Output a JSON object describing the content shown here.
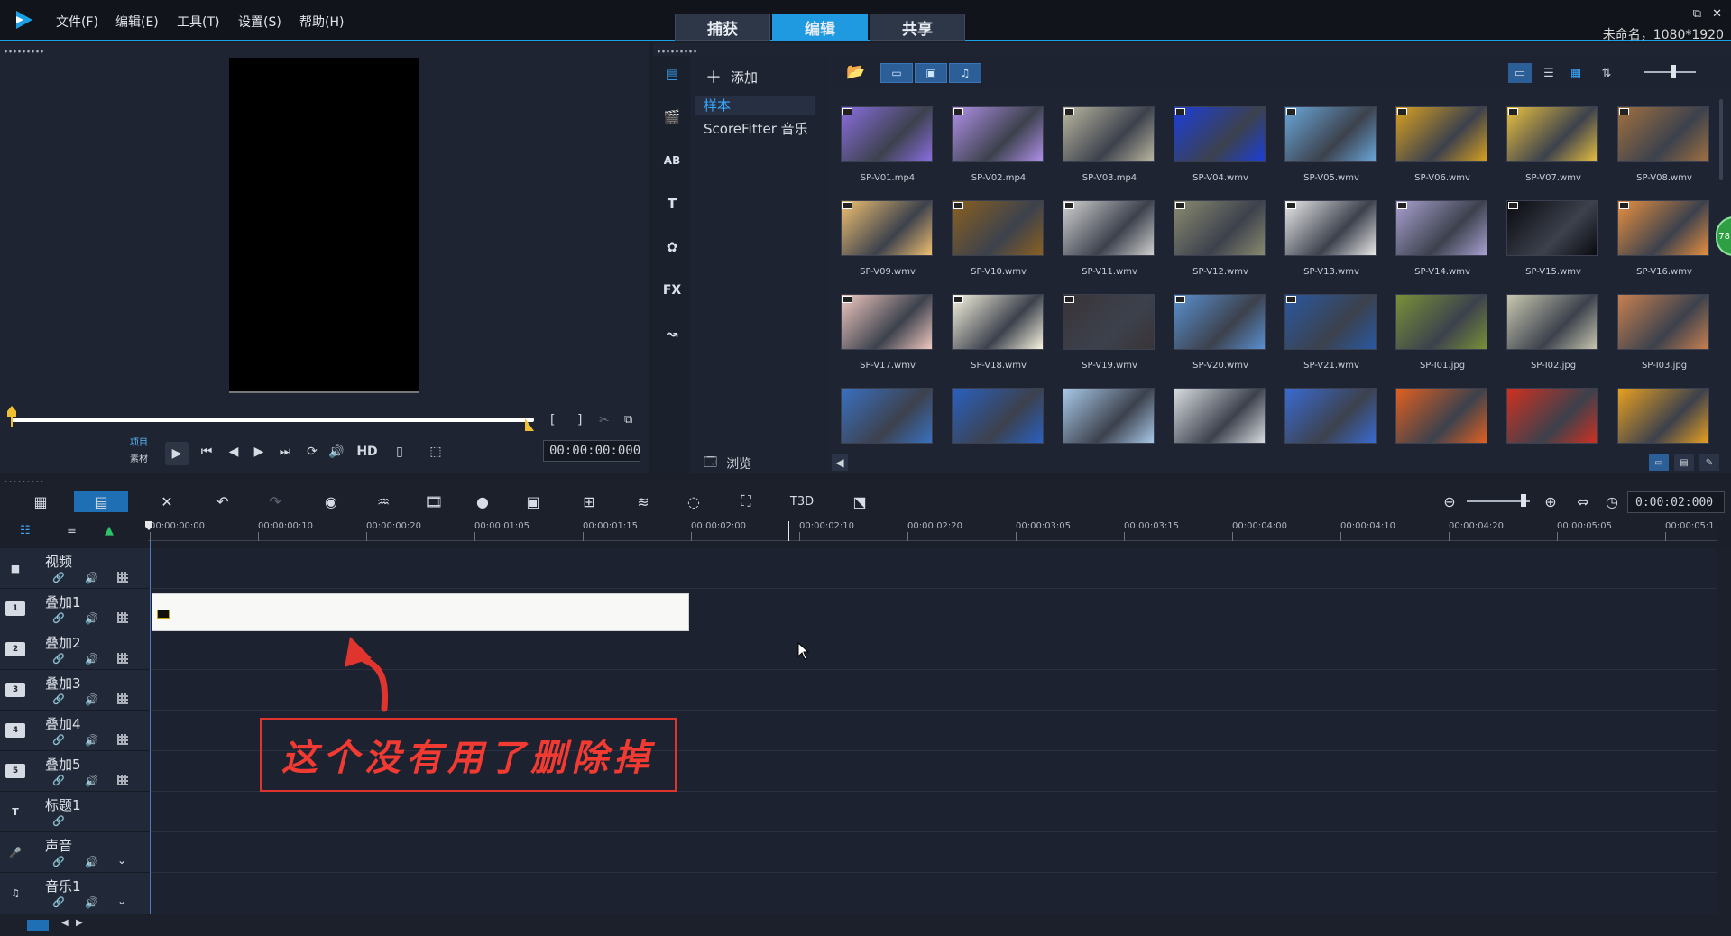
{
  "menu": [
    "文件(F)",
    "编辑(E)",
    "工具(T)",
    "设置(S)",
    "帮助(H)"
  ],
  "mode_tabs": [
    "捕获",
    "编辑",
    "共享"
  ],
  "window_controls": [
    "—",
    "⧉",
    "✕"
  ],
  "project_info": "未命名，1080*1920",
  "player": {
    "mode_project": "项目",
    "mode_clip": "素材",
    "hd_label": "HD",
    "timecode": "00:00:00:000"
  },
  "library": {
    "add_label": "添加",
    "tree_items": [
      "样本",
      "ScoreFitter 音乐"
    ],
    "browse_label": "浏览",
    "side_icons": [
      "media-icon",
      "instant-project-icon",
      "transition-icon",
      "title-icon",
      "graphic-icon",
      "filter-icon",
      "path-icon"
    ],
    "badge": "78",
    "thumbnails": [
      {
        "label": "SP-V01.mp4",
        "color": "#8a6ee0",
        "video": true
      },
      {
        "label": "SP-V02.mp4",
        "color": "#b090e8",
        "video": true
      },
      {
        "label": "SP-V03.mp4",
        "color": "#bab6a0",
        "video": true
      },
      {
        "label": "SP-V04.wmv",
        "color": "#1c3ed8",
        "video": true
      },
      {
        "label": "SP-V05.wmv",
        "color": "#6aa6d8",
        "video": true
      },
      {
        "label": "SP-V06.wmv",
        "color": "#d8a020",
        "video": true
      },
      {
        "label": "SP-V07.wmv",
        "color": "#e8c040",
        "video": true
      },
      {
        "label": "SP-V08.wmv",
        "color": "#a07040",
        "video": true
      },
      {
        "label": "SP-V09.wmv",
        "color": "#f0c070",
        "video": true
      },
      {
        "label": "SP-V10.wmv",
        "color": "#8a6020",
        "video": true
      },
      {
        "label": "SP-V11.wmv",
        "color": "#d0d0d0",
        "video": true
      },
      {
        "label": "SP-V12.wmv",
        "color": "#8a8a70",
        "video": true
      },
      {
        "label": "SP-V13.wmv",
        "color": "#e8e8e8",
        "video": true
      },
      {
        "label": "SP-V14.wmv",
        "color": "#a8a0d0",
        "video": true
      },
      {
        "label": "SP-V15.wmv",
        "color": "#0a0a10",
        "video": true
      },
      {
        "label": "SP-V16.wmv",
        "color": "#e89040",
        "video": true
      },
      {
        "label": "SP-V17.wmv",
        "color": "#f0c8c0",
        "video": true
      },
      {
        "label": "SP-V18.wmv",
        "color": "#f8f4e0",
        "video": true
      },
      {
        "label": "SP-V19.wmv",
        "color": "#3a3438",
        "video": true
      },
      {
        "label": "SP-V20.wmv",
        "color": "#5a90d0",
        "video": true
      },
      {
        "label": "SP-V21.wmv",
        "color": "#2a58a0",
        "video": true
      },
      {
        "label": "SP-I01.jpg",
        "color": "#7a9038",
        "video": false
      },
      {
        "label": "SP-I02.jpg",
        "color": "#c8c8b0",
        "video": false
      },
      {
        "label": "SP-I03.jpg",
        "color": "#c88050",
        "video": false
      },
      {
        "label": "",
        "color": "#3a70c0",
        "video": false
      },
      {
        "label": "",
        "color": "#2a60c0",
        "video": false
      },
      {
        "label": "",
        "color": "#a8c8e8",
        "video": false
      },
      {
        "label": "",
        "color": "#d8dce0",
        "video": false
      },
      {
        "label": "",
        "color": "#3a6ad0",
        "video": false
      },
      {
        "label": "",
        "color": "#e06020",
        "video": false
      },
      {
        "label": "",
        "color": "#d03020",
        "video": false
      },
      {
        "label": "",
        "color": "#e8a020",
        "video": false
      }
    ]
  },
  "timeline": {
    "timecode": "0:00:02:000",
    "ruler_labels": [
      "00:00:00:00",
      "00:00:00:10",
      "00:00:00:20",
      "00:00:01:05",
      "00:00:01:15",
      "00:00:02:00",
      "00:00:02:10",
      "00:00:02:20",
      "00:00:03:05",
      "00:00:03:15",
      "00:00:04:00",
      "00:00:04:10",
      "00:00:04:20",
      "00:00:05:05",
      "00:00:05:1"
    ],
    "tracks": [
      {
        "name": "视频",
        "icon": "video-track-icon",
        "badge": "",
        "audio": "🔊",
        "extra": "grid"
      },
      {
        "name": "叠加1",
        "icon": "overlay-track-icon",
        "badge": "1",
        "audio": "🔊",
        "extra": "grid"
      },
      {
        "name": "叠加2",
        "icon": "overlay-track-icon",
        "badge": "2",
        "audio": "🔊",
        "extra": "grid"
      },
      {
        "name": "叠加3",
        "icon": "overlay-track-icon",
        "badge": "3",
        "audio": "🔊",
        "extra": "grid"
      },
      {
        "name": "叠加4",
        "icon": "overlay-track-icon",
        "badge": "4",
        "audio": "🔊",
        "extra": "grid"
      },
      {
        "name": "叠加5",
        "icon": "overlay-track-icon",
        "badge": "5",
        "audio": "🔊",
        "extra": "grid"
      },
      {
        "name": "标题1",
        "icon": "title-track-icon",
        "badge": "T",
        "audio": "",
        "extra": ""
      },
      {
        "name": "声音",
        "icon": "voice-track-icon",
        "badge": "",
        "audio": "🔊",
        "extra": "chev"
      },
      {
        "name": "音乐1",
        "icon": "music-track-icon",
        "badge": "",
        "audio": "🔊",
        "extra": "chev"
      }
    ]
  },
  "annotation": "这个没有用了删除掉"
}
